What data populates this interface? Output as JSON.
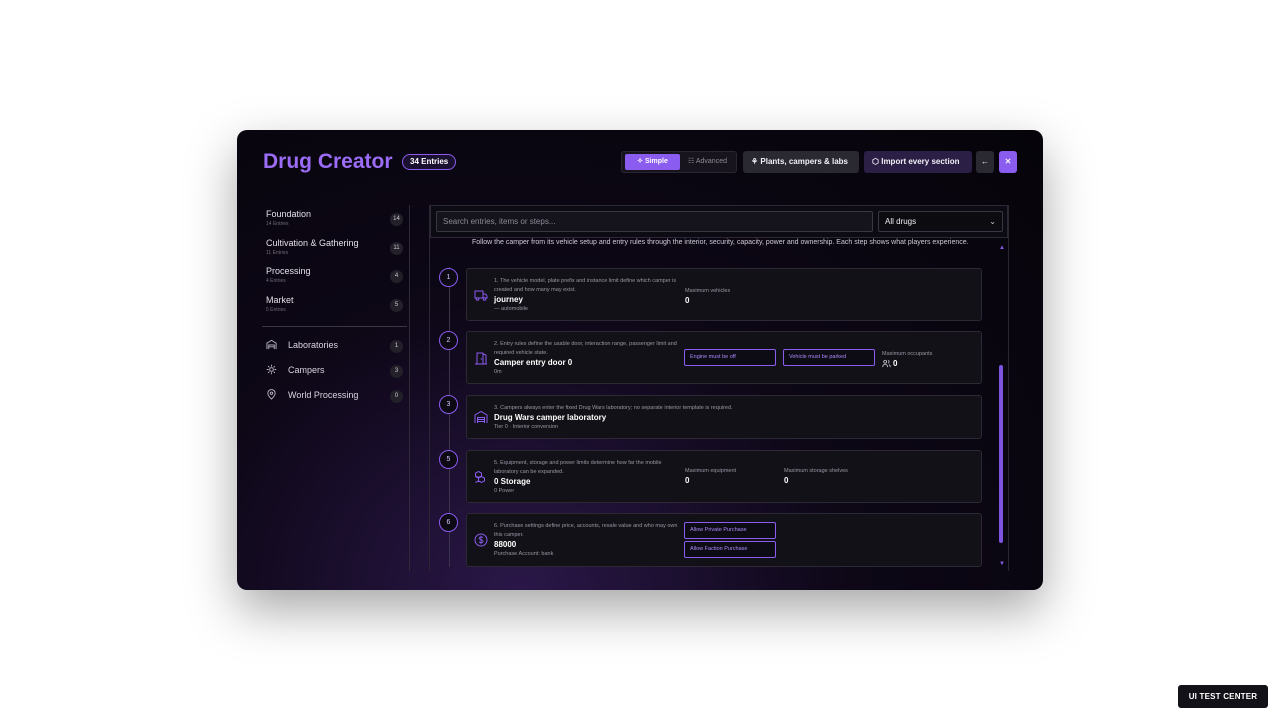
{
  "app": {
    "title": "Drug Creator",
    "entries_badge": "34 Entries"
  },
  "header": {
    "mode_simple": "Simple",
    "mode_advanced": "Advanced",
    "plants_button": "Plants, campers & labs",
    "import_button": "Import every section",
    "back_icon": "arrow-left-icon",
    "close_icon": "close-icon"
  },
  "sidebar": {
    "categories": [
      {
        "label": "Foundation",
        "sub": "14 Entries",
        "count": "14"
      },
      {
        "label": "Cultivation & Gathering",
        "sub": "11 Entries",
        "count": "11"
      },
      {
        "label": "Processing",
        "sub": "4 Entries",
        "count": "4"
      },
      {
        "label": "Market",
        "sub": "5 Entries",
        "count": "5"
      }
    ],
    "links": [
      {
        "label": "Laboratories",
        "count": "1",
        "icon": "warehouse-icon"
      },
      {
        "label": "Campers",
        "count": "3",
        "icon": "gear-icon"
      },
      {
        "label": "World Processing",
        "count": "0",
        "icon": "location-pin-icon"
      }
    ]
  },
  "main": {
    "search_placeholder": "Search entries, items or steps...",
    "filter_value": "All drugs",
    "intro": "Follow the camper from its vehicle setup and entry rules through the interior, security, capacity, power and ownership. Each step shows what players experience.",
    "steps": [
      {
        "num": "1",
        "desc": "1. The vehicle model, plate prefix and instance limit define which camper is created and how many may exist.",
        "value": "journey",
        "sub": "— automobile",
        "fields": [
          {
            "label": "Maximum vehicles",
            "value": "0"
          }
        ]
      },
      {
        "num": "2",
        "desc": "2. Entry rules define the usable door, interaction range, passenger limit and required vehicle state.",
        "value": "Camper entry door 0",
        "sub": "0m",
        "options": [
          "Engine must be off",
          "Vehicle must be parked"
        ],
        "fields": [
          {
            "label": "Maximum occupants",
            "value": "0"
          }
        ]
      },
      {
        "num": "3",
        "desc": "3. Campers always enter the fixed Drug Wars laboratory; no separate interior template is required.",
        "value": "Drug Wars camper laboratory",
        "sub": "Tier 0 · Interior conversion"
      },
      {
        "num": "5",
        "desc": "5. Equipment, storage and power limits determine how far the mobile laboratory can be expanded.",
        "value": "0 Storage",
        "sub": "0 Power",
        "fields": [
          {
            "label": "Maximum equipment",
            "value": "0"
          },
          {
            "label": "Maximum storage shelves",
            "value": "0"
          }
        ]
      },
      {
        "num": "6",
        "desc": "6. Purchase settings define price, accounts, resale value and who may own this camper.",
        "value": "88000",
        "sub": "Purchase Account: bank",
        "options": [
          "Allow Private Purchase",
          "Allow Faction Purchase"
        ]
      }
    ]
  },
  "footer_badge": "UI TEST CENTER",
  "colors": {
    "accent": "#8a5cf0",
    "background": "#06040a",
    "card": "#121117"
  }
}
